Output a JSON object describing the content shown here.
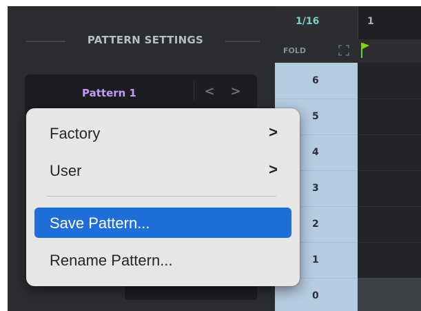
{
  "panel": {
    "title": "PATTERN SETTINGS",
    "pattern_name": "Pattern 1",
    "prev_glyph": "<",
    "next_glyph": ">"
  },
  "sequencer": {
    "step_resolution": "1/16",
    "bar_number": "1",
    "fold_label": "FOLD",
    "keys": [
      "6",
      "5",
      "4",
      "3",
      "2",
      "1",
      "0"
    ]
  },
  "menu": {
    "items": [
      {
        "label": "Factory",
        "submenu": true,
        "chevron": ">"
      },
      {
        "label": "User",
        "submenu": true,
        "chevron": ">"
      },
      {
        "label": "Save Pattern...",
        "highlighted": true
      },
      {
        "label": "Rename Pattern..."
      }
    ]
  },
  "colors": {
    "accent_blue": "#1f6fd8",
    "pattern_purple": "#c29bf3",
    "resolution_teal": "#7ad0c3",
    "flag_green": "#7ed321"
  },
  "icons": [
    "expand-icon",
    "flag-icon",
    "chevron-left-icon",
    "chevron-right-icon"
  ]
}
